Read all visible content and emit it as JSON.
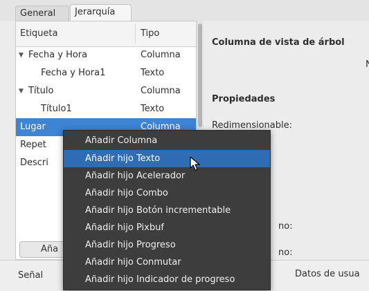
{
  "tabs": [
    {
      "label": "General"
    },
    {
      "label": "Jerarquía"
    }
  ],
  "tree": {
    "headers": {
      "label": "Etiqueta",
      "type": "Tipo"
    },
    "rows": [
      {
        "label": "Fecha y Hora",
        "type": "Columna",
        "expanded": true
      },
      {
        "label": "Fecha y Hora1",
        "type": "Texto"
      },
      {
        "label": "Título",
        "type": "Columna",
        "expanded": true
      },
      {
        "label": "Título1",
        "type": "Texto"
      },
      {
        "label": "Lugar",
        "type": "Columna"
      },
      {
        "label": "Repet",
        "type": ""
      },
      {
        "label": "Descri",
        "type": ""
      }
    ],
    "add_button_label": "Aña"
  },
  "properties": {
    "title": "Columna de vista de árbol",
    "truncated_char": "N",
    "section": "Propiedades",
    "resizable_label": "Redimensionable:",
    "truncated_1": "no:",
    "truncated_2": "no:"
  },
  "bottom": {
    "signal_label": "Señal",
    "user_data_label": "Datos de usua"
  },
  "context_menu": {
    "items": [
      "Añadir Columna",
      "Añadir hijo Texto",
      "Añadir hijo Acelerador",
      "Añadir hijo Combo",
      "Añadir hijo Botón incrementable",
      "Añadir hijo Pixbuf",
      "Añadir hijo Progreso",
      "Añadir hijo Conmutar",
      "Añadir hijo Indicador de progreso"
    ],
    "active_index": 1
  },
  "colors": {
    "selection": "#3d84d2",
    "menu_bg": "#3d3d3d",
    "menu_highlight": "#2f6cb4"
  }
}
